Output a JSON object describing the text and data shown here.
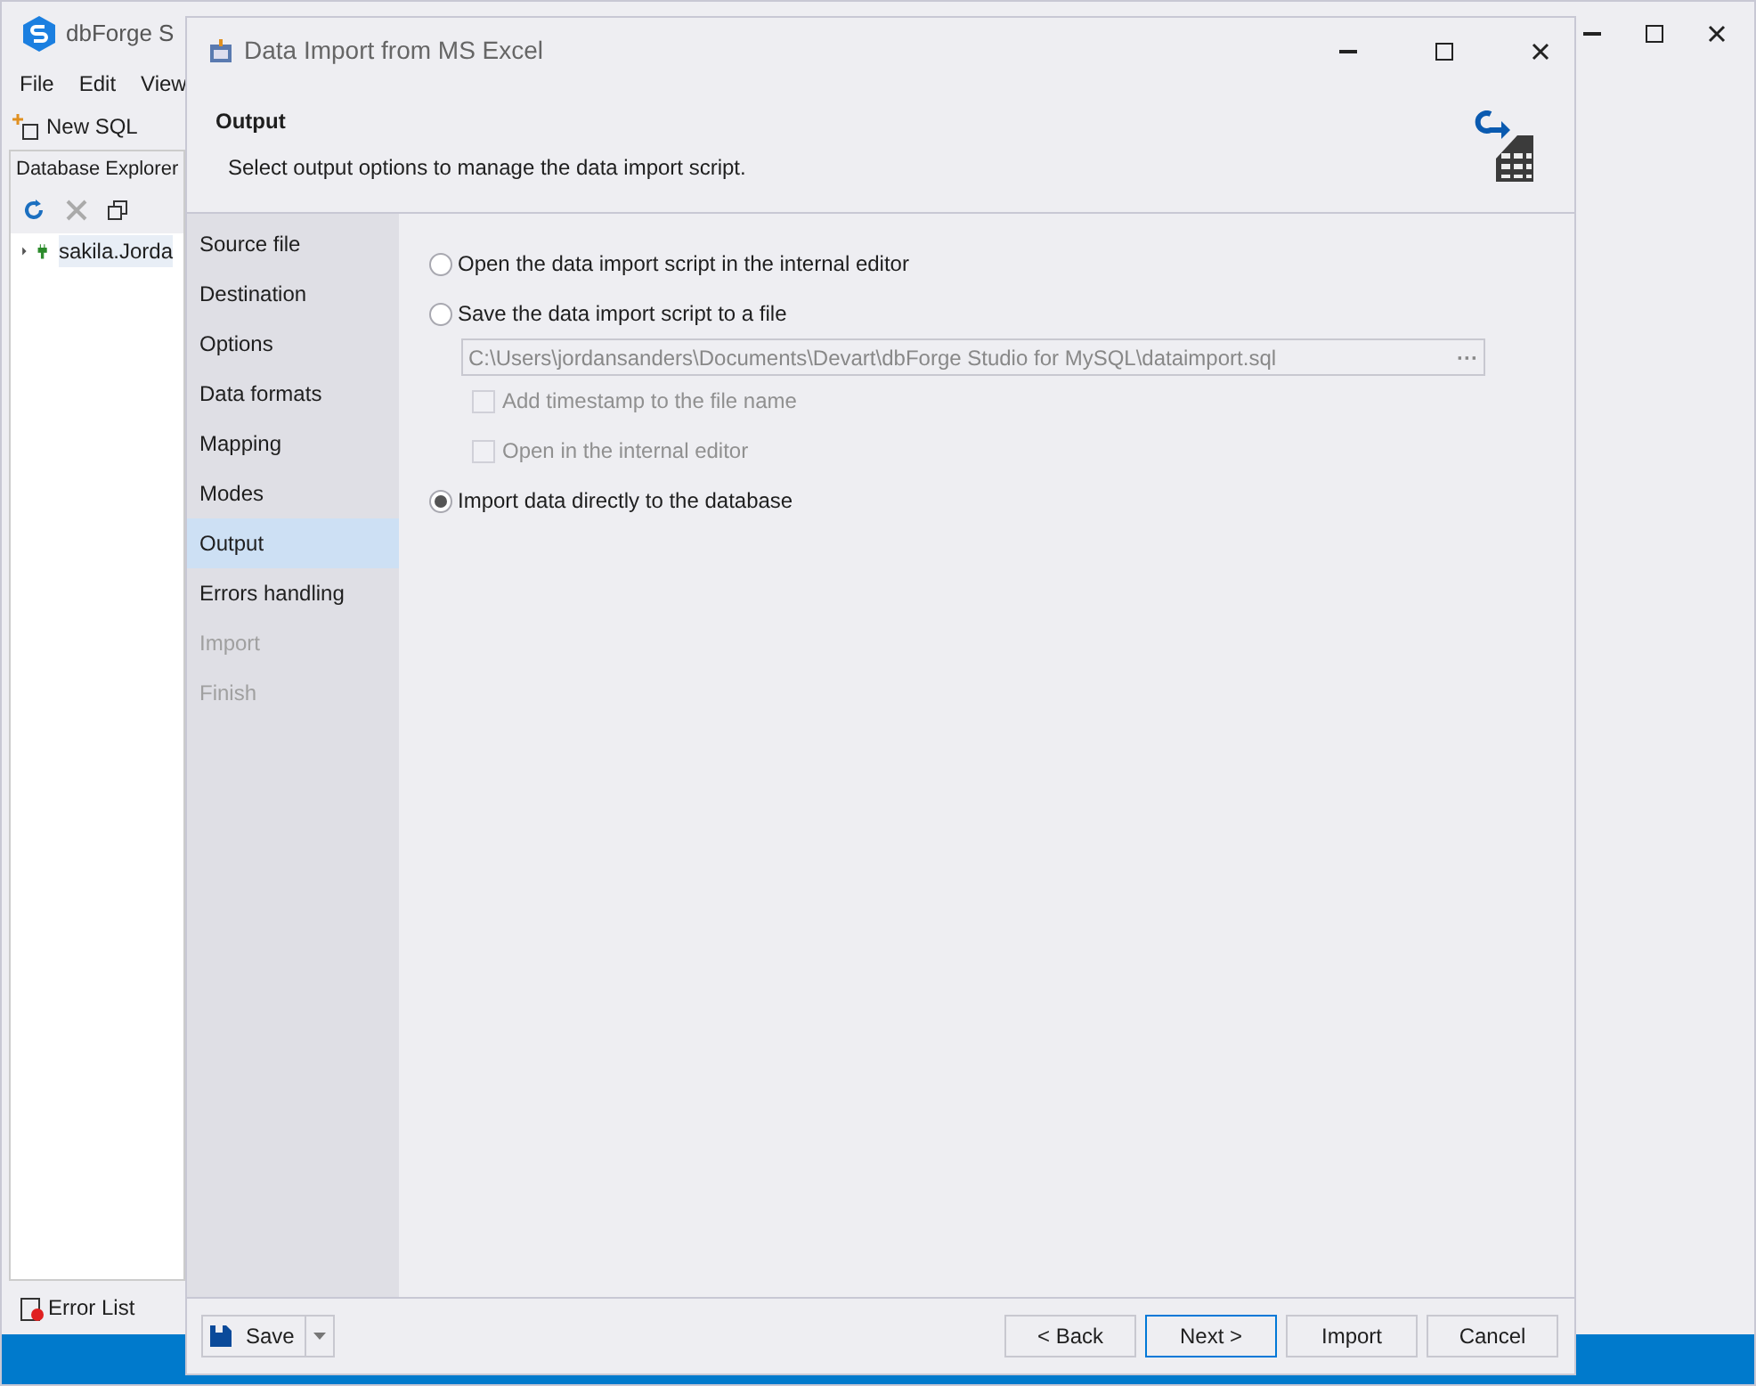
{
  "main_window": {
    "title": "dbForge S",
    "menu": [
      "File",
      "Edit",
      "View"
    ],
    "toolbar": [
      "New SQL"
    ],
    "explorer": {
      "title": "Database Explorer",
      "tree": [
        {
          "label": "sakila.Jorda",
          "expanded": false
        }
      ]
    },
    "error_list": "Error List"
  },
  "dialog": {
    "title": "Data Import from MS Excel",
    "header": {
      "title": "Output",
      "description": "Select output options to manage the data import script."
    },
    "steps": [
      {
        "label": "Source file",
        "selected": false,
        "disabled": false
      },
      {
        "label": "Destination",
        "selected": false,
        "disabled": false
      },
      {
        "label": "Options",
        "selected": false,
        "disabled": false
      },
      {
        "label": "Data formats",
        "selected": false,
        "disabled": false
      },
      {
        "label": "Mapping",
        "selected": false,
        "disabled": false
      },
      {
        "label": "Modes",
        "selected": false,
        "disabled": false
      },
      {
        "label": "Output",
        "selected": true,
        "disabled": false
      },
      {
        "label": "Errors handling",
        "selected": false,
        "disabled": false
      },
      {
        "label": "Import",
        "selected": false,
        "disabled": true
      },
      {
        "label": "Finish",
        "selected": false,
        "disabled": true
      }
    ],
    "options": [
      {
        "kind": "radio",
        "label": "Open the data import script in the internal editor",
        "selected": false
      },
      {
        "kind": "radio",
        "label": "Save the data import script to a file",
        "selected": false
      },
      {
        "kind": "path",
        "value": "C:\\Users\\jordansanders\\Documents\\Devart\\dbForge Studio for MySQL\\dataimport.sql",
        "button": "···",
        "disabled": true
      },
      {
        "kind": "checkbox",
        "label": "Add timestamp to the file name",
        "checked": false,
        "disabled": true
      },
      {
        "kind": "checkbox",
        "label": "Open in the internal editor",
        "checked": false,
        "disabled": true
      },
      {
        "kind": "radio",
        "label": "Import data directly to the database",
        "selected": true
      }
    ],
    "save_button": "Save",
    "buttons": [
      {
        "label": "< Back",
        "focused": false
      },
      {
        "label": "Next >",
        "focused": true
      },
      {
        "label": "Import",
        "focused": false
      },
      {
        "label": "Cancel",
        "focused": false
      }
    ]
  }
}
